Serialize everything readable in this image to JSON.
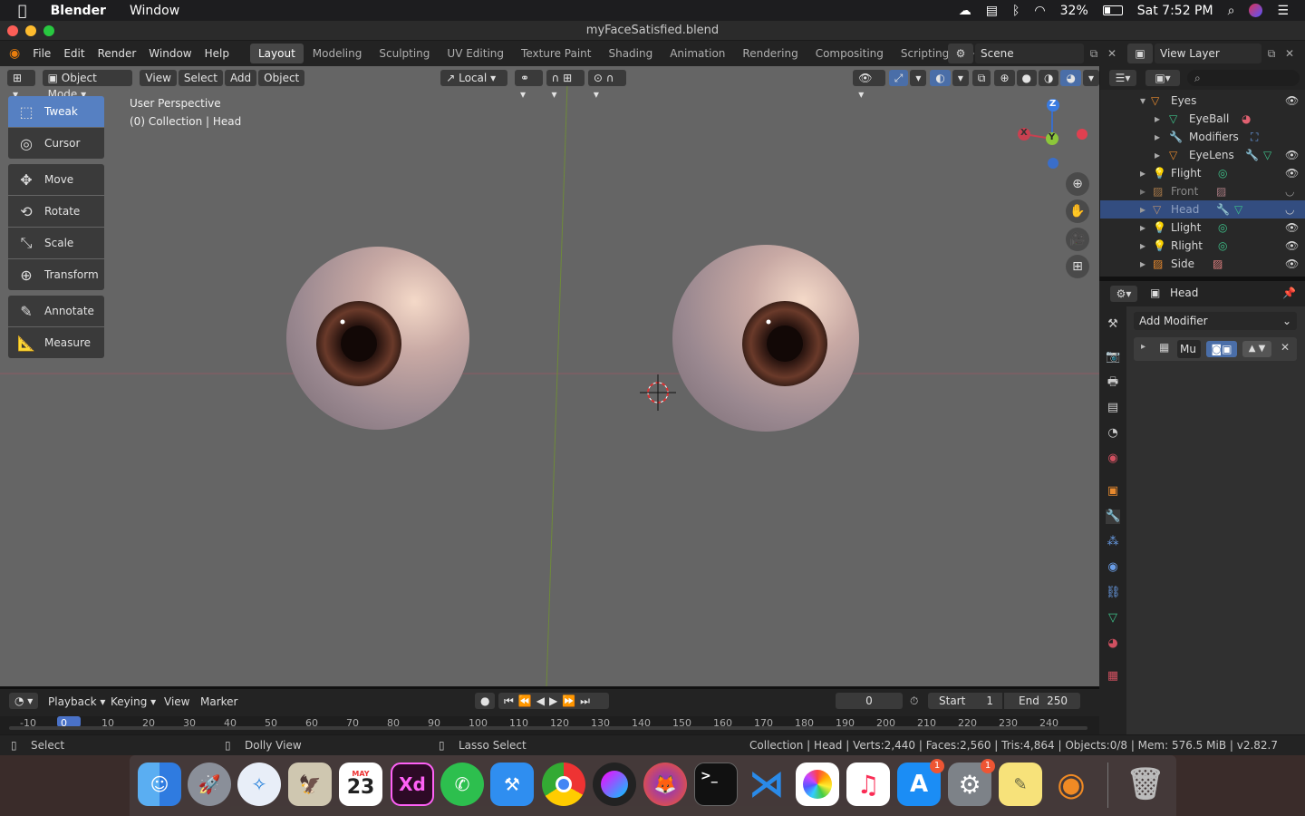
{
  "mac": {
    "apple_icon": "apple-icon",
    "app_name": "Blender",
    "menu_window": "Window",
    "battery": "32%",
    "datetime": "Sat 7:52 PM"
  },
  "window": {
    "title": "myFaceSatisfied.blend"
  },
  "topbar": {
    "menus": [
      "File",
      "Edit",
      "Render",
      "Window",
      "Help"
    ],
    "tabs": [
      "Layout",
      "Modeling",
      "Sculpting",
      "UV Editing",
      "Texture Paint",
      "Shading",
      "Animation",
      "Rendering",
      "Compositing",
      "Scripting"
    ],
    "active_tab": "Layout",
    "add_tab": "+",
    "scene": "Scene",
    "view_layer": "View Layer"
  },
  "viewport": {
    "mode": "Object Mode",
    "menus": [
      "View",
      "Select",
      "Add",
      "Object"
    ],
    "transform_orientation": "Local",
    "overlay_title": "User Perspective",
    "overlay_collection": "(0) Collection | Head",
    "tools": [
      "Tweak",
      "Cursor",
      "Move",
      "Rotate",
      "Scale",
      "Transform",
      "Annotate",
      "Measure"
    ],
    "gizmo": {
      "x": "X",
      "y": "Y",
      "z": "Z"
    }
  },
  "outliner": {
    "items": [
      {
        "label": "Eyes",
        "indent": 0,
        "visible": true
      },
      {
        "label": "EyeBall",
        "indent": 1,
        "visible": false
      },
      {
        "label": "Modifiers",
        "indent": 1,
        "visible": false
      },
      {
        "label": "EyeLens",
        "indent": 1,
        "visible": true
      },
      {
        "label": "Flight",
        "indent": 0,
        "visible": true
      },
      {
        "label": "Front",
        "indent": 0,
        "visible": false
      },
      {
        "label": "Head",
        "indent": 0,
        "visible": false
      },
      {
        "label": "Llight",
        "indent": 0,
        "visible": true
      },
      {
        "label": "Rlight",
        "indent": 0,
        "visible": true
      },
      {
        "label": "Side",
        "indent": 0,
        "visible": true
      }
    ]
  },
  "properties": {
    "object_name": "Head",
    "add_modifier": "Add Modifier",
    "modifier_name": "Mu"
  },
  "timeline": {
    "menus": [
      "Playback",
      "Keying",
      "View",
      "Marker"
    ],
    "current_frame": "0",
    "start_label": "Start",
    "start": "1",
    "end_label": "End",
    "end": "250",
    "ruler": [
      "-10",
      "0",
      "10",
      "20",
      "30",
      "40",
      "50",
      "60",
      "70",
      "80",
      "90",
      "100",
      "110",
      "120",
      "130",
      "140",
      "150",
      "160",
      "170",
      "180",
      "190",
      "200",
      "210",
      "220",
      "230",
      "240"
    ]
  },
  "status": {
    "select": "Select",
    "dolly": "Dolly View",
    "lasso": "Lasso Select",
    "stats": "Collection | Head | Verts:2,440 | Faces:2,560 | Tris:4,864 | Objects:0/8 | Mem: 576.5 MiB | v2.82.7"
  },
  "dock": {
    "calendar_month": "MAY",
    "calendar_day": "23",
    "xd": "Xd",
    "badge": "1"
  }
}
